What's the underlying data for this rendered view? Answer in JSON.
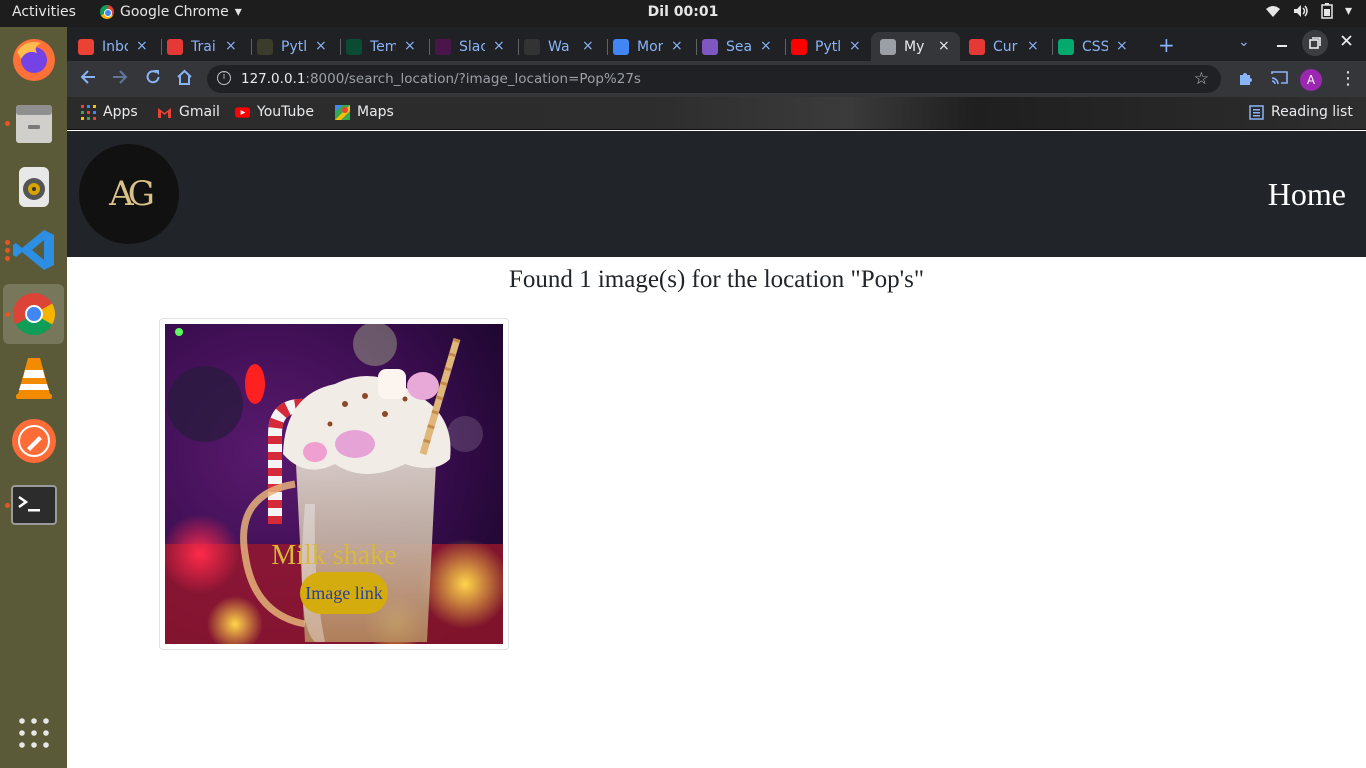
{
  "system": {
    "activities": "Activities",
    "app_name": "Google Chrome",
    "clock": "Dil 00:01"
  },
  "dock": {
    "items": [
      "firefox-icon",
      "files-icon",
      "rhythmbox-icon",
      "vscode-icon",
      "chrome-icon",
      "vlc-icon",
      "postman-icon",
      "terminal-icon"
    ],
    "show_apps": "apps-grid-icon"
  },
  "browser": {
    "tabs": [
      {
        "title": "Inbo",
        "icon": "gmail-icon",
        "color": "#ea4335"
      },
      {
        "title": "Trai",
        "icon": "trailhead-icon",
        "color": "#e53935"
      },
      {
        "title": "Pytl",
        "icon": "python-icon",
        "color": "#3c3c2c"
      },
      {
        "title": "Tem",
        "icon": "django-icon",
        "color": "#0c4b33"
      },
      {
        "title": "Slac",
        "icon": "slack-icon",
        "color": "#4a154b"
      },
      {
        "title": "Wa",
        "icon": "github-icon",
        "color": "#333333"
      },
      {
        "title": "Mon",
        "icon": "calendar-icon",
        "color": "#4285f4"
      },
      {
        "title": "Sea",
        "icon": "tor-icon",
        "color": "#7e57c2"
      },
      {
        "title": "Pytl",
        "icon": "youtube-icon",
        "color": "#ff0000"
      },
      {
        "title": "My",
        "icon": "globe-icon",
        "color": "#9aa0a6"
      },
      {
        "title": "Cur",
        "icon": "asterisk-icon",
        "color": "#e53935"
      },
      {
        "title": "CSS",
        "icon": "w3schools-icon",
        "color": "#04aa6d"
      }
    ],
    "url_host": "127.0.0.1",
    "url_path": ":8000/search_location/?image_location=Pop%27s",
    "bookmarks": [
      "Apps",
      "Gmail",
      "YouTube",
      "Maps"
    ],
    "reading_list": "Reading list",
    "avatar_letter": "A"
  },
  "page": {
    "logo_text": "AG",
    "nav_home": "Home",
    "result_heading": "Found 1 image(s) for the location \"Pop's\"",
    "card": {
      "title": "Milk shake",
      "button": "Image link"
    }
  }
}
